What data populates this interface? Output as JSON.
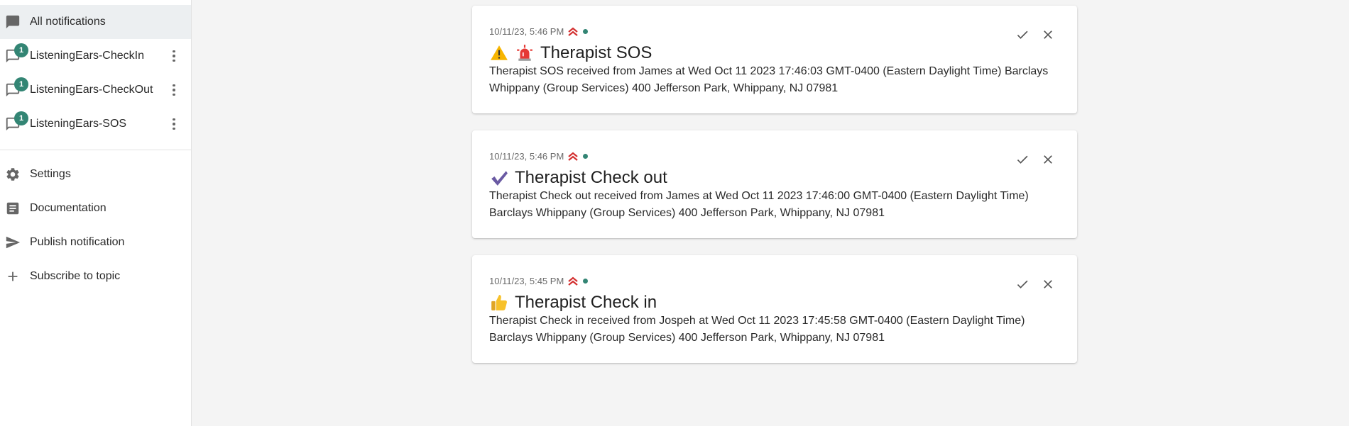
{
  "sidebar": {
    "all_notifications": "All notifications",
    "topics": [
      {
        "label": "ListeningEars-CheckIn",
        "badge": "1"
      },
      {
        "label": "ListeningEars-CheckOut",
        "badge": "1"
      },
      {
        "label": "ListeningEars-SOS",
        "badge": "1"
      }
    ],
    "settings": "Settings",
    "documentation": "Documentation",
    "publish": "Publish notification",
    "subscribe": "Subscribe to topic"
  },
  "notifications": [
    {
      "time": "10/11/23, 5:46 PM",
      "tags": [
        "warning-emoji",
        "rotating-light-emoji"
      ],
      "title": "Therapist SOS",
      "message": "Therapist SOS received from James at Wed Oct 11 2023 17:46:03 GMT-0400 (Eastern Daylight Time) Barclays Whippany (Group Services) 400 Jefferson Park, Whippany, NJ 07981"
    },
    {
      "time": "10/11/23, 5:46 PM",
      "tags": [
        "check-mark-emoji"
      ],
      "title": "Therapist Check out",
      "message": "Therapist Check out received from James at Wed Oct 11 2023 17:46:00 GMT-0400 (Eastern Daylight Time) Barclays Whippany (Group Services) 400 Jefferson Park, Whippany, NJ 07981"
    },
    {
      "time": "10/11/23, 5:45 PM",
      "tags": [
        "thumbs-up-emoji"
      ],
      "title": "Therapist Check in",
      "message": "Therapist Check in received from Jospeh at Wed Oct 11 2023 17:45:58 GMT-0400 (Eastern Daylight Time) Barclays Whippany (Group Services) 400 Jefferson Park, Whippany, NJ 07981"
    }
  ],
  "colors": {
    "accent": "#338574",
    "priority": "#d32f2f",
    "sidebar_selected": "#eceff1",
    "background": "#f4f4f4"
  }
}
